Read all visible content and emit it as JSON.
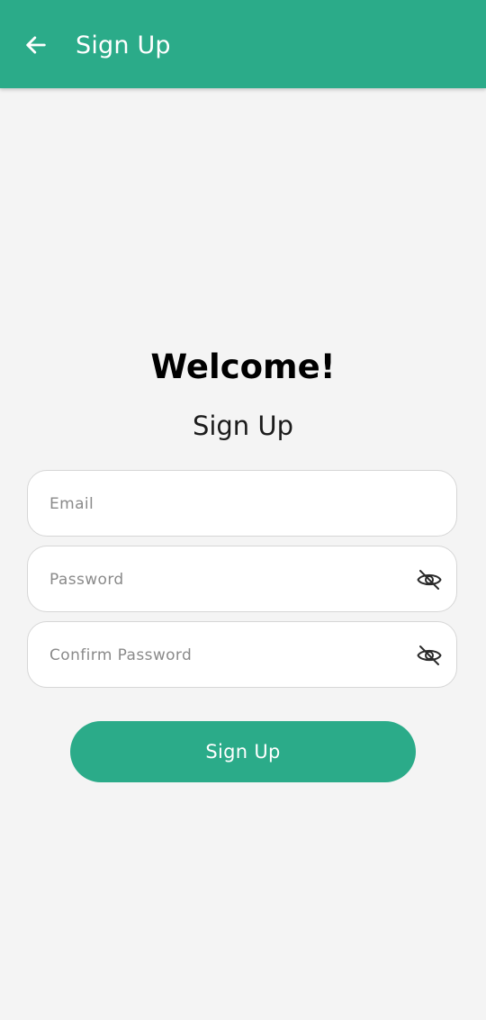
{
  "appbar": {
    "title": "Sign Up",
    "back_icon": "arrow-left-icon",
    "color": "#2bab89"
  },
  "main": {
    "heading": "Welcome!",
    "subheading": "Sign Up"
  },
  "form": {
    "email_placeholder": "Email",
    "password_placeholder": "Password",
    "confirm_password_placeholder": "Confirm Password",
    "visibility_icon": "eye-off-icon",
    "submit_label": "Sign Up"
  }
}
